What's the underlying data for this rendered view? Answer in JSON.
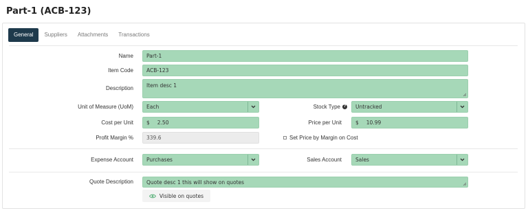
{
  "page": {
    "title": "Part-1 (ACB-123)"
  },
  "tabs": [
    {
      "label": "General",
      "active": true
    },
    {
      "label": "Suppliers",
      "active": false
    },
    {
      "label": "Attachments",
      "active": false
    },
    {
      "label": "Transactions",
      "active": false
    }
  ],
  "form": {
    "name": {
      "label": "Name",
      "value": "Part-1"
    },
    "item_code": {
      "label": "Item Code",
      "value": "ACB-123"
    },
    "description": {
      "label": "Description",
      "value": "Item desc 1"
    },
    "uom": {
      "label": "Unit of Measure (UoM)",
      "value": "Each"
    },
    "stock_type": {
      "label": "Stock Type",
      "value": "Untracked",
      "icon": "info-icon"
    },
    "cost_per_unit": {
      "label": "Cost per Unit",
      "currency": "$",
      "value": "2.50"
    },
    "price_per_unit": {
      "label": "Price per Unit",
      "currency": "$",
      "value": "10.99"
    },
    "profit_margin": {
      "label": "Profit Margin %",
      "value": "339.6"
    },
    "set_price_by_margin": {
      "label": "Set Price by Margin on Cost",
      "checked": false
    },
    "expense_account": {
      "label": "Expense Account",
      "value": "Purchases"
    },
    "sales_account": {
      "label": "Sales Account",
      "value": "Sales"
    },
    "quote_description": {
      "label": "Quote Description",
      "value": "Quote desc 1  this will show on quotes"
    },
    "visible_on_quotes": {
      "label": "Visible on quotes",
      "icon": "eye-icon"
    }
  },
  "colors": {
    "field_bg": "#a6d8b8",
    "active_tab_bg": "#1e3a4c",
    "readonly_bg": "#ececec"
  }
}
